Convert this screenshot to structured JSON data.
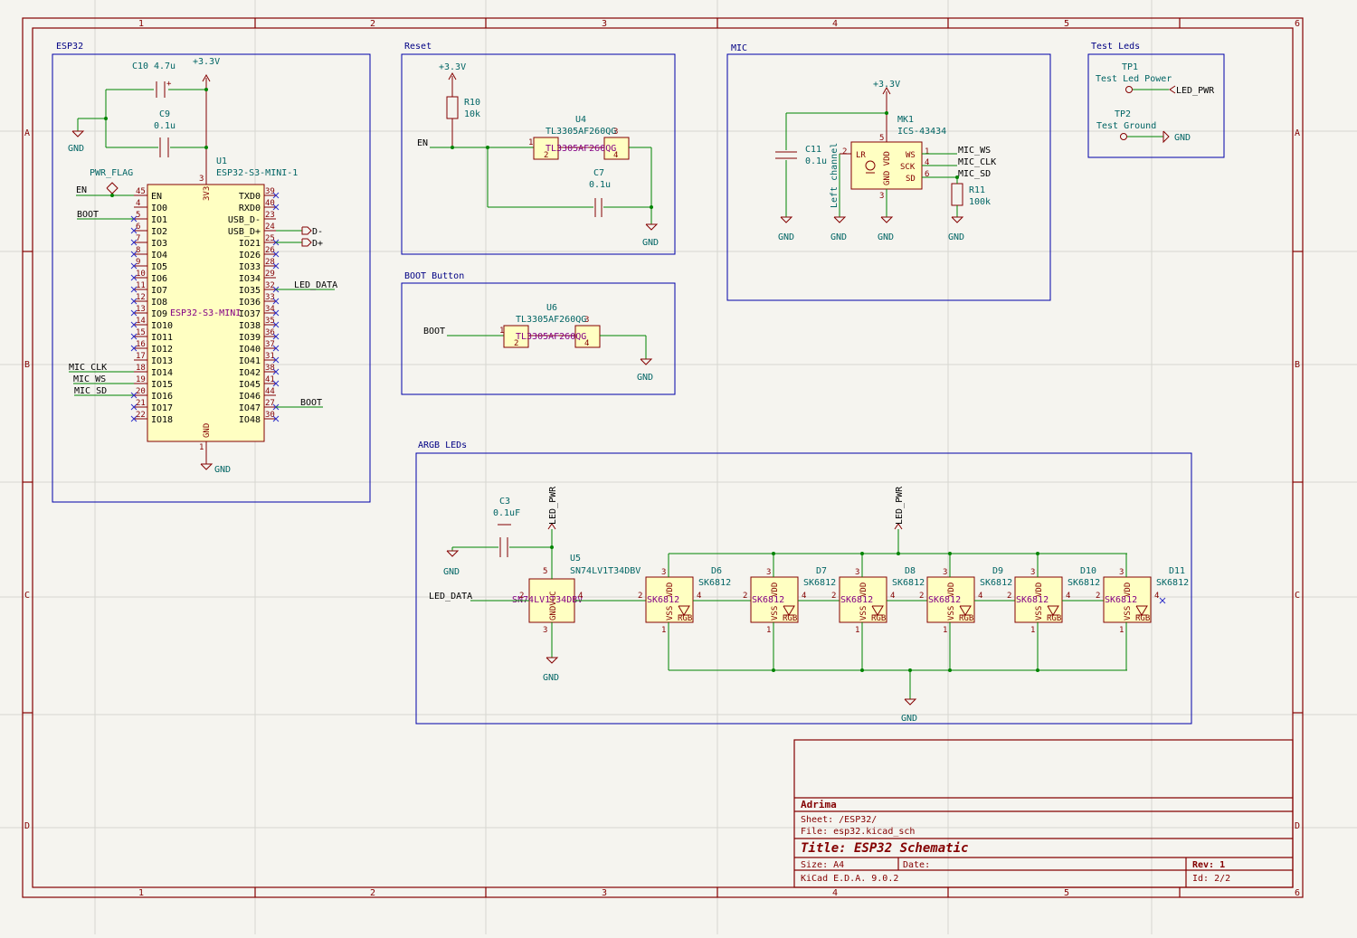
{
  "frame": {
    "col_labels": [
      "1",
      "2",
      "3",
      "4",
      "5",
      "6"
    ],
    "row_labels": [
      "A",
      "B",
      "C",
      "D"
    ]
  },
  "sections": {
    "esp32": "ESP32",
    "reset": "Reset",
    "mic": "MIC",
    "test_leds": "Test Leds",
    "boot_button": "BOOT Button",
    "argb": "ARGB LEDs"
  },
  "esp32": {
    "c10_ref": "C10",
    "c10_val": "4.7u",
    "c9_ref": "C9",
    "c9_val": "0.1u",
    "u1_ref": "U1",
    "u1_val": "ESP32-S3-MINI-1",
    "u1_body": "ESP32-S3-MINI",
    "pwr_flag": "PWR_FLAG",
    "v33": "+3.3V",
    "gnd": "GND",
    "pin_3v3": "3V3",
    "pin_gnd": "GND",
    "left_pins": [
      {
        "num": "45",
        "name": "EN"
      },
      {
        "num": "4",
        "name": "IO0"
      },
      {
        "num": "5",
        "name": "IO1"
      },
      {
        "num": "6",
        "name": "IO2"
      },
      {
        "num": "7",
        "name": "IO3"
      },
      {
        "num": "8",
        "name": "IO4"
      },
      {
        "num": "9",
        "name": "IO5"
      },
      {
        "num": "10",
        "name": "IO6"
      },
      {
        "num": "11",
        "name": "IO7"
      },
      {
        "num": "12",
        "name": "IO8"
      },
      {
        "num": "13",
        "name": "IO9"
      },
      {
        "num": "14",
        "name": "IO10"
      },
      {
        "num": "15",
        "name": "IO11"
      },
      {
        "num": "16",
        "name": "IO12"
      },
      {
        "num": "17",
        "name": "IO13"
      },
      {
        "num": "18",
        "name": "IO14"
      },
      {
        "num": "19",
        "name": "IO15"
      },
      {
        "num": "20",
        "name": "IO16"
      },
      {
        "num": "21",
        "name": "IO17"
      },
      {
        "num": "22",
        "name": "IO18"
      }
    ],
    "right_pins": [
      {
        "num": "39",
        "name": "TXD0"
      },
      {
        "num": "40",
        "name": "RXD0"
      },
      {
        "num": "23",
        "name": "USB_D-"
      },
      {
        "num": "24",
        "name": "USB_D+"
      },
      {
        "num": "25",
        "name": "IO21"
      },
      {
        "num": "26",
        "name": "IO26"
      },
      {
        "num": "28",
        "name": "IO33"
      },
      {
        "num": "29",
        "name": "IO34"
      },
      {
        "num": "32",
        "name": "IO35"
      },
      {
        "num": "33",
        "name": "IO36"
      },
      {
        "num": "34",
        "name": "IO37"
      },
      {
        "num": "35",
        "name": "IO38"
      },
      {
        "num": "36",
        "name": "IO39"
      },
      {
        "num": "37",
        "name": "IO40"
      },
      {
        "num": "31",
        "name": "IO41"
      },
      {
        "num": "38",
        "name": "IO42"
      },
      {
        "num": "41",
        "name": "IO45"
      },
      {
        "num": "44",
        "name": "IO46"
      },
      {
        "num": "27",
        "name": "IO47"
      },
      {
        "num": "30",
        "name": "IO48"
      }
    ],
    "nets": {
      "en": "EN",
      "boot": "BOOT",
      "mic_clk": "MIC_CLK",
      "mic_ws": "MIC_WS",
      "mic_sd": "MIC_SD",
      "led_data": "LED_DATA",
      "boot2": "BOOT",
      "dminus": "D-",
      "dplus": "D+"
    },
    "pin_num_3v3": "3",
    "pin_num_gnd": "1"
  },
  "reset": {
    "v33": "+3.3V",
    "r10_ref": "R10",
    "r10_val": "10k",
    "u4_ref": "U4",
    "u4_val": "TL3305AF260QG",
    "u4_body": "TL3305AF260QG",
    "c7_ref": "C7",
    "c7_val": "0.1u",
    "en": "EN",
    "gnd": "GND",
    "p1": "1",
    "p2": "2",
    "p3": "3",
    "p4": "4"
  },
  "boot": {
    "u6_ref": "U6",
    "u6_val": "TL3305AF260QG",
    "u6_body": "TL3305AF260QG",
    "net": "BOOT",
    "gnd": "GND",
    "p1": "1",
    "p2": "2",
    "p3": "3",
    "p4": "4"
  },
  "mic": {
    "v33": "+3.3V",
    "mk1_ref": "MK1",
    "mk1_val": "ICS-43434",
    "c11_ref": "C11",
    "c11_val": "0.1u",
    "lr": "LR",
    "gnd_vdd": "GND VDD",
    "ws": "WS",
    "sck": "SCK",
    "sd": "SD",
    "left_channel": "Left channel",
    "net_ws": "MIC_WS",
    "net_clk": "MIC_CLK",
    "net_sd": "MIC_SD",
    "r11_ref": "R11",
    "r11_val": "100k",
    "gnd": "GND",
    "p1": "1",
    "p2": "2",
    "p3": "3",
    "p4": "4",
    "p5": "5",
    "p6": "6"
  },
  "test": {
    "tp1_ref": "TP1",
    "tp1_val": "Test Led Power",
    "led_pwr": "LED_PWR",
    "tp2_ref": "TP2",
    "tp2_val": "Test Ground",
    "gnd": "GND"
  },
  "argb": {
    "c3_ref": "C3",
    "c3_val": "0.1uF",
    "led_pwr": "LED_PWR",
    "led_pwr2": "LED_PWR",
    "u5_ref": "U5",
    "u5_val": "SN74LV1T34DBV",
    "u5_body": "SN74LV1T34DBV",
    "gndvcc": "GNDVCC",
    "led_data": "LED_DATA",
    "gnd": "GND",
    "gnd2": "GND",
    "gnd3": "GND",
    "leds": [
      {
        "ref": "D6",
        "val": "SK6812"
      },
      {
        "ref": "D7",
        "val": "SK6812"
      },
      {
        "ref": "D8",
        "val": "SK6812"
      },
      {
        "ref": "D9",
        "val": "SK6812"
      },
      {
        "ref": "D10",
        "val": "SK6812"
      },
      {
        "ref": "D11",
        "val": "SK6812"
      }
    ],
    "led_body": "SK6812",
    "vdd": "VDD",
    "vss": "VSS",
    "rgb": "RGB",
    "p1": "1",
    "p2": "2",
    "p3": "3",
    "p4": "4",
    "p5": "5"
  },
  "titleblock": {
    "company": "Adrima",
    "sheet": "Sheet: /ESP32/",
    "file": "File: esp32.kicad_sch",
    "title": "Title: ESP32 Schematic",
    "size": "Size: A4",
    "date": "Date:",
    "rev": "Rev: 1",
    "tool": "KiCad E.D.A. 9.0.2",
    "id": "Id: 2/2"
  },
  "colors": {
    "frame": "#840000",
    "wire": "#008400",
    "sheet": "#0000a8",
    "body": "#ffffc2"
  }
}
